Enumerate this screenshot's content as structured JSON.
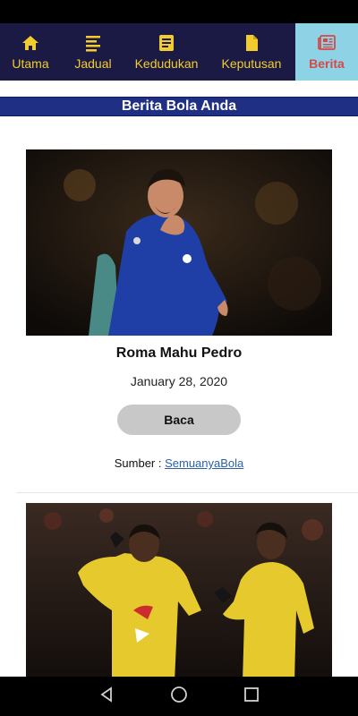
{
  "tabs": [
    {
      "label": "Utama",
      "icon": "home-icon"
    },
    {
      "label": "Jadual",
      "icon": "list-icon"
    },
    {
      "label": "Kedudukan",
      "icon": "standings-icon"
    },
    {
      "label": "Keputusan",
      "icon": "document-icon"
    },
    {
      "label": "Berita",
      "icon": "newspaper-icon",
      "active": true
    }
  ],
  "header": {
    "title": "Berita Bola Anda"
  },
  "articles": [
    {
      "title": "Roma Mahu Pedro",
      "date": "January 28, 2020",
      "read_label": "Baca",
      "source_prefix": "Sumber : ",
      "source_link": "SemuanyaBola"
    }
  ],
  "colors": {
    "tab_bar": "#1b1a45",
    "tab_text": "#f2cc2f",
    "active_tab_bg": "#8ed2e6",
    "active_tab_text": "#d44a4a",
    "header_bg": "#1f2f83",
    "link": "#2a61a8"
  }
}
